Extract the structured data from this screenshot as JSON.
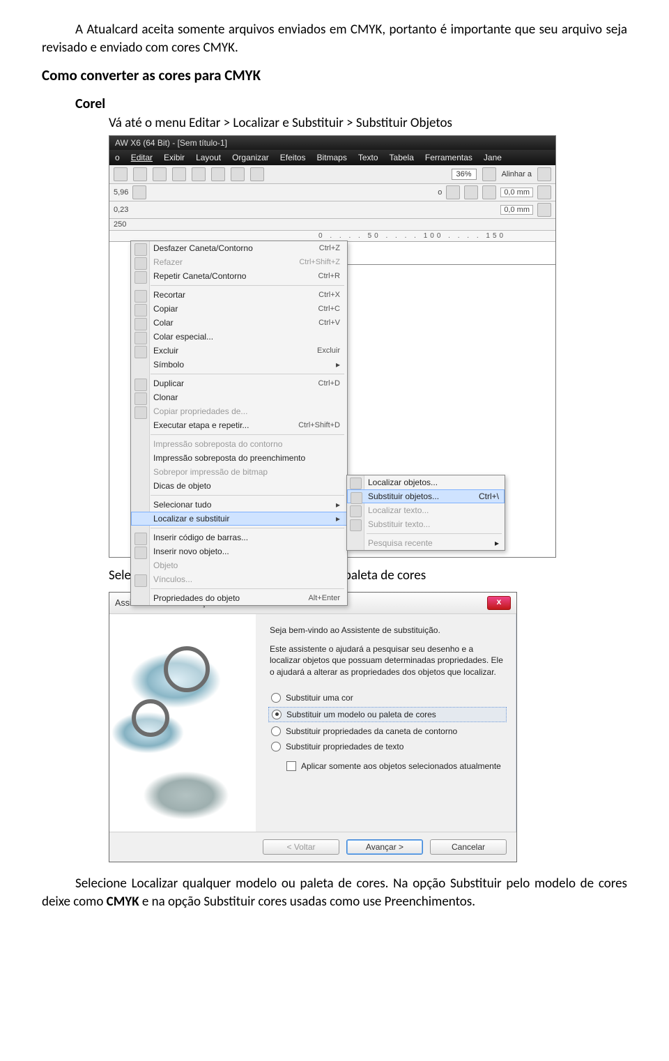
{
  "doc": {
    "p1": "A Atualcard aceita somente arquivos enviados em CMYK, portanto é importante que seu arquivo seja revisado e enviado com cores CMYK.",
    "heading": "Como converter as cores para CMYK",
    "subhead": "Corel",
    "step1": "Vá até o menu Editar > Localizar e Substituir > Substituir Objetos",
    "caption1": "Selecione a opção Substituir um modelo ou paleta de cores",
    "p2_pre": "Selecione Localizar qualquer modelo ou paleta de cores. Na opção Substituir pelo modelo de cores deixe como ",
    "p2_bold": "CMYK",
    "p2_post": " e na opção Substituir cores usadas como use Preenchimentos."
  },
  "corel": {
    "title": "AW X6 (64 Bit) - [Sem título-1]",
    "menus": {
      "arquivo": "o",
      "editar": "Editar",
      "exibir": "Exibir",
      "layout": "Layout",
      "organizar": "Organizar",
      "efeitos": "Efeitos",
      "bitmaps": "Bitmaps",
      "texto": "Texto",
      "tabela": "Tabela",
      "ferramentas": "Ferramentas",
      "jan": "Jane"
    },
    "zoom": "36%",
    "alinhar": "Alinhar a",
    "coord1": "5,96",
    "coord2": "0,23",
    "coord3": "250",
    "deg": "o",
    "mm1": "0,0 mm",
    "mm2": "0,0 mm",
    "ruler": "0 . . . . 50 . . . . 100 . . . . 150",
    "items": {
      "desfazer": {
        "l": "Desfazer Caneta/Contorno",
        "s": "Ctrl+Z"
      },
      "refazer": {
        "l": "Refazer",
        "s": "Ctrl+Shift+Z"
      },
      "repetir": {
        "l": "Repetir Caneta/Contorno",
        "s": "Ctrl+R"
      },
      "recortar": {
        "l": "Recortar",
        "s": "Ctrl+X"
      },
      "copiar": {
        "l": "Copiar",
        "s": "Ctrl+C"
      },
      "colar": {
        "l": "Colar",
        "s": "Ctrl+V"
      },
      "colarEsp": {
        "l": "Colar especial..."
      },
      "excluir": {
        "l": "Excluir",
        "s": "Excluir"
      },
      "simbolo": {
        "l": "Símbolo"
      },
      "duplicar": {
        "l": "Duplicar",
        "s": "Ctrl+D"
      },
      "clonar": {
        "l": "Clonar"
      },
      "copProp": {
        "l": "Copiar propriedades de..."
      },
      "etapa": {
        "l": "Executar etapa e repetir...",
        "s": "Ctrl+Shift+D"
      },
      "impContorno": {
        "l": "Impressão sobreposta do contorno"
      },
      "impPreen": {
        "l": "Impressão sobreposta do preenchimento"
      },
      "sobrepor": {
        "l": "Sobrepor impressão de bitmap"
      },
      "dicas": {
        "l": "Dicas de objeto"
      },
      "selTudo": {
        "l": "Selecionar tudo"
      },
      "locSub": {
        "l": "Localizar e substituir"
      },
      "insBarras": {
        "l": "Inserir código de barras..."
      },
      "insNovo": {
        "l": "Inserir novo objeto..."
      },
      "objeto": {
        "l": "Objeto"
      },
      "vinculos": {
        "l": "Vínculos..."
      },
      "props": {
        "l": "Propriedades do objeto",
        "s": "Alt+Enter"
      }
    },
    "sub": {
      "locObj": {
        "l": "Localizar objetos..."
      },
      "subObj": {
        "l": "Substituir objetos...",
        "s": "Ctrl+\\"
      },
      "locTexto": {
        "l": "Localizar texto..."
      },
      "subTexto": {
        "l": "Substituir texto..."
      },
      "pesquisa": {
        "l": "Pesquisa recente"
      }
    },
    "tri": "▸"
  },
  "wizard": {
    "title": "Assistente de substituição",
    "close": "x",
    "intro": "Seja bem-vindo ao Assistente de substituição.",
    "desc": "Este assistente o ajudará a pesquisar seu desenho e a localizar objetos que possuam determinadas propriedades. Ele o ajudará a alterar as propriedades dos objetos que localizar.",
    "opt1": "Substituir uma cor",
    "opt2": "Substituir um modelo ou paleta de cores",
    "opt3": "Substituir propriedades da caneta de contorno",
    "opt4": "Substituir propriedades de texto",
    "chk": "Aplicar somente aos objetos selecionados atualmente",
    "back": "< Voltar",
    "next": "Avançar >",
    "cancel": "Cancelar"
  }
}
